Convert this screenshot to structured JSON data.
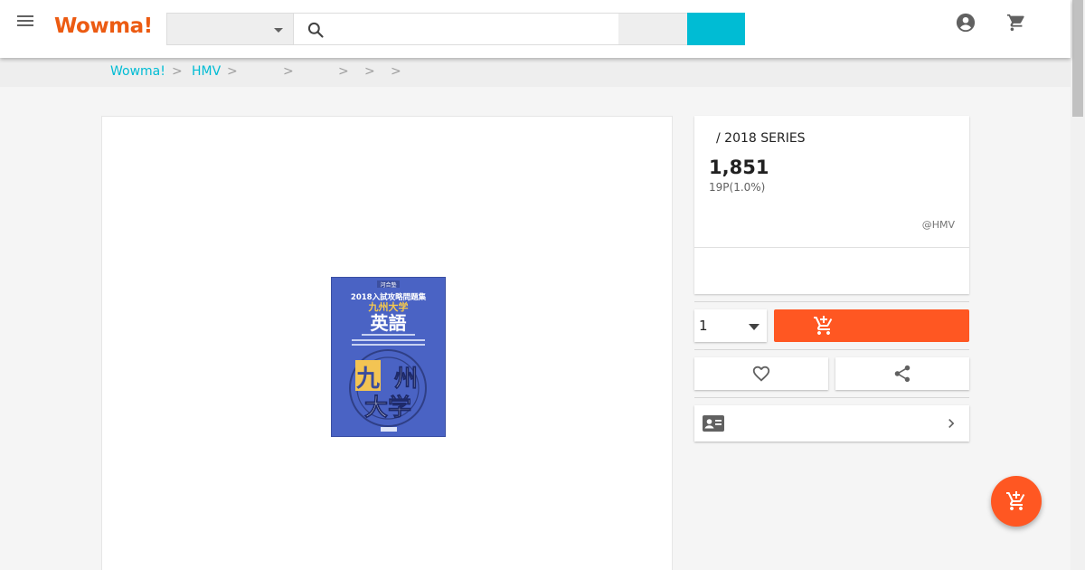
{
  "header": {
    "logo": "Wowma!",
    "search": {
      "value": "",
      "placeholder": ""
    },
    "icons": {
      "menu": "menu-icon",
      "search": "search-icon",
      "account": "account-circle-icon",
      "cart": "shopping-cart-icon"
    }
  },
  "breadcrumb": {
    "items": [
      "Wowma!",
      "HMV"
    ],
    "separator": ">"
  },
  "product": {
    "title": "/  2018 SERIES",
    "price": "1,851",
    "points": "19P(1.0%)",
    "seller": "@HMV",
    "cover_text": {
      "top": "河合塾",
      "series": "2018入試攻略問題集",
      "university": "九州大学",
      "subject": "英語",
      "big_left": "九",
      "big_right": "州",
      "big_bottom": "大学"
    }
  },
  "purchase": {
    "quantity": "1"
  },
  "colors": {
    "accent": "#00bcd4",
    "brand": "#ec5b12",
    "cart": "#ff5722"
  }
}
